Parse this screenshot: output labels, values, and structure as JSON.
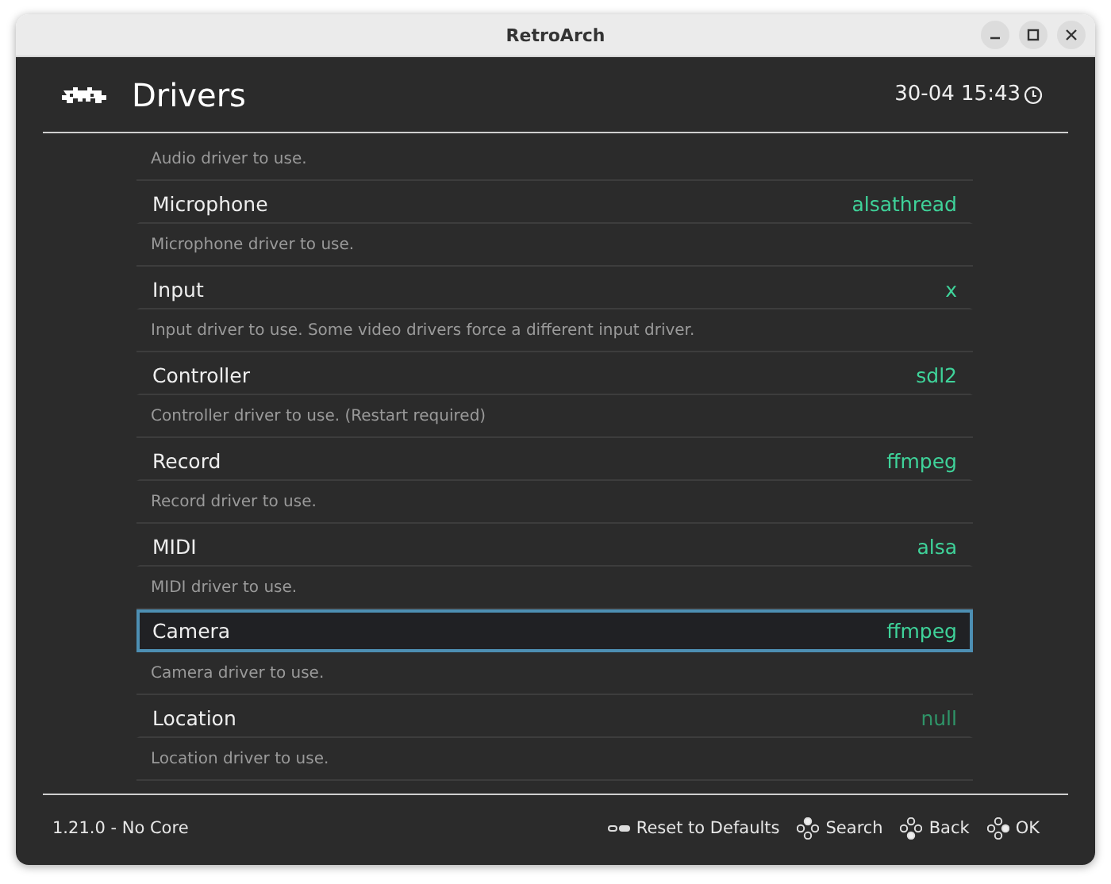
{
  "window": {
    "title": "RetroArch"
  },
  "header": {
    "title": "Drivers",
    "clock": "30-04 15:43"
  },
  "list": {
    "top_description": "Audio driver to use.",
    "items": [
      {
        "label": "Microphone",
        "value": "alsathread",
        "description": "Microphone driver to use.",
        "selected": false,
        "disabled": false
      },
      {
        "label": "Input",
        "value": "x",
        "description": "Input driver to use. Some video drivers force a different input driver.",
        "selected": false,
        "disabled": false
      },
      {
        "label": "Controller",
        "value": "sdl2",
        "description": "Controller driver to use. (Restart required)",
        "selected": false,
        "disabled": false
      },
      {
        "label": "Record",
        "value": "ffmpeg",
        "description": "Record driver to use.",
        "selected": false,
        "disabled": false
      },
      {
        "label": "MIDI",
        "value": "alsa",
        "description": "MIDI driver to use.",
        "selected": false,
        "disabled": false
      },
      {
        "label": "Camera",
        "value": "ffmpeg",
        "description": "Camera driver to use.",
        "selected": true,
        "disabled": false
      },
      {
        "label": "Location",
        "value": "null",
        "description": "Location driver to use.",
        "selected": false,
        "disabled": true
      }
    ]
  },
  "footer": {
    "version": "1.21.0 - No Core",
    "actions": [
      {
        "kind": "reset",
        "label": "Reset to Defaults"
      },
      {
        "kind": "search",
        "label": "Search"
      },
      {
        "kind": "back",
        "label": "Back"
      },
      {
        "kind": "ok",
        "label": "OK"
      }
    ]
  }
}
